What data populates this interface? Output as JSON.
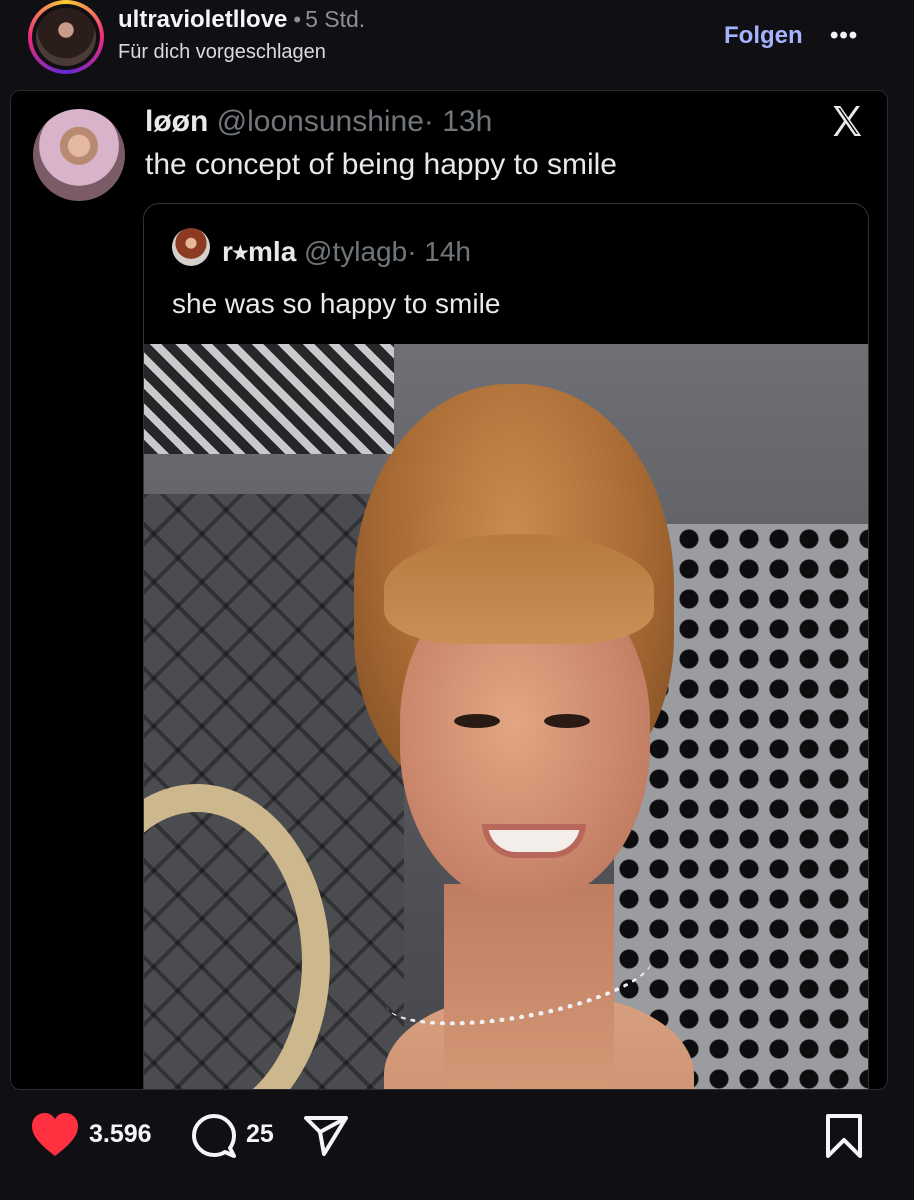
{
  "header": {
    "username": "ultravioletllove",
    "separator": "•",
    "time": "5 Std.",
    "suggested": "Für dich vorgeschlagen",
    "follow_label": "Folgen",
    "more_label": "•••"
  },
  "tweet": {
    "name": "løøn",
    "handle": "@loonsunshine",
    "time": "· 13h",
    "text": "the concept of being happy to smile",
    "quote": {
      "name": "r⭒mla",
      "handle": "@tylagb",
      "time": "· 14h",
      "text": "she was so happy to smile"
    }
  },
  "footer": {
    "likes": "3.596",
    "comments": "25"
  },
  "colors": {
    "background": "#101014",
    "card": "#000000",
    "follow_accent": "#a6b4ff",
    "like_red": "#ff3040",
    "muted": "#71767b"
  },
  "icons": {
    "x_logo": "x-logo-icon",
    "heart": "heart-icon",
    "comment": "comment-icon",
    "share": "share-icon",
    "bookmark": "bookmark-icon"
  }
}
